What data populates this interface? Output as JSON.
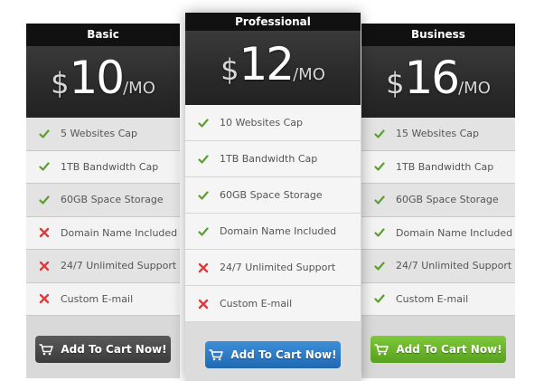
{
  "plans": [
    {
      "name": "Basic",
      "currency": "$",
      "amount": "10",
      "period": "/MO",
      "features": [
        {
          "label": "5 Websites Cap",
          "included": true
        },
        {
          "label": "1TB Bandwidth Cap",
          "included": true
        },
        {
          "label": "60GB Space Storage",
          "included": true
        },
        {
          "label": "Domain Name Included",
          "included": false
        },
        {
          "label": "24/7 Unlimited Support",
          "included": false
        },
        {
          "label": "Custom E-mail",
          "included": false
        }
      ],
      "button_label": "Add To Cart Now!",
      "button_color": "#4a4a4a"
    },
    {
      "name": "Professional",
      "currency": "$",
      "amount": "12",
      "period": "/MO",
      "features": [
        {
          "label": "10 Websites Cap",
          "included": true
        },
        {
          "label": "1TB Bandwidth Cap",
          "included": true
        },
        {
          "label": "60GB Space Storage",
          "included": true
        },
        {
          "label": "Domain Name Included",
          "included": true
        },
        {
          "label": "24/7 Unlimited Support",
          "included": false
        },
        {
          "label": "Custom E-mail",
          "included": false
        }
      ],
      "button_label": "Add To Cart Now!",
      "button_color": "#2e7cc6"
    },
    {
      "name": "Business",
      "currency": "$",
      "amount": "16",
      "period": "/MO",
      "features": [
        {
          "label": "15 Websites Cap",
          "included": true
        },
        {
          "label": "1TB Bandwidth Cap",
          "included": true
        },
        {
          "label": "60GB Space Storage",
          "included": true
        },
        {
          "label": "Domain Name Included",
          "included": true
        },
        {
          "label": "24/7 Unlimited Support",
          "included": true
        },
        {
          "label": "Custom E-mail",
          "included": true
        }
      ],
      "button_label": "Add To Cart Now!",
      "button_color": "#6bb52c"
    }
  ],
  "icons": {
    "included": "check-icon",
    "excluded": "cross-icon",
    "button": "cart-icon"
  },
  "colors": {
    "check": "#5aa02c",
    "cross": "#e03a3a",
    "header": "#111111",
    "price_bg": "#2b2b2b"
  }
}
